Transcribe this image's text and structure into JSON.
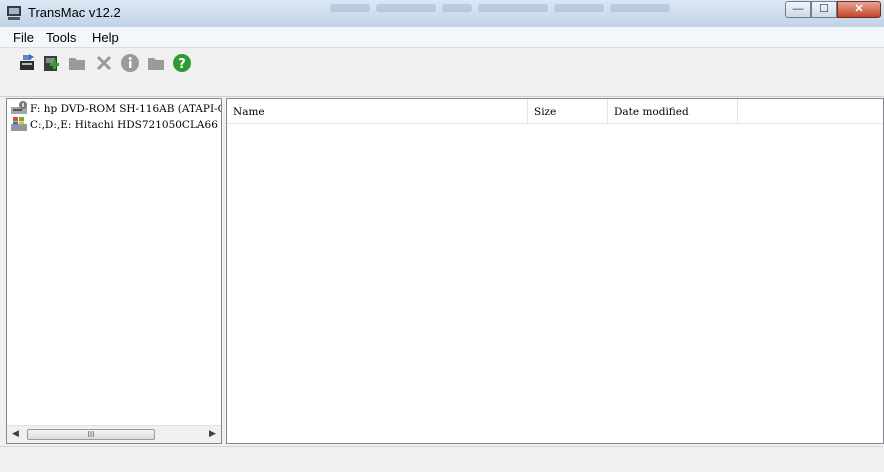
{
  "window": {
    "title": "TransMac v12.2",
    "controls": {
      "minimize": "—",
      "maximize": "☐",
      "close": "✕"
    }
  },
  "menu": {
    "items": [
      {
        "label": "File"
      },
      {
        "label": "Tools"
      },
      {
        "label": "Help"
      }
    ]
  },
  "toolbar": {
    "icons": [
      {
        "name": "open-drive-icon"
      },
      {
        "name": "new-image-icon"
      },
      {
        "name": "folder-icon"
      },
      {
        "name": "delete-icon"
      },
      {
        "name": "info-icon"
      },
      {
        "name": "new-folder-icon"
      },
      {
        "name": "help-icon"
      }
    ]
  },
  "tree": {
    "items": [
      {
        "label": "F:  hp DVD-ROM SH-116AB (ATAPI-C"
      },
      {
        "label": "C:,D:,E:  Hitachi HDS721050CLA66"
      }
    ],
    "scrollbar": {
      "grip": "III"
    }
  },
  "list": {
    "columns": [
      {
        "label": "Name"
      },
      {
        "label": "Size"
      },
      {
        "label": "Date modified"
      }
    ]
  },
  "colors": {
    "titlebar": "#c2d3e6",
    "help_green": "#2f9a2f",
    "close_red": "#c6452c"
  }
}
